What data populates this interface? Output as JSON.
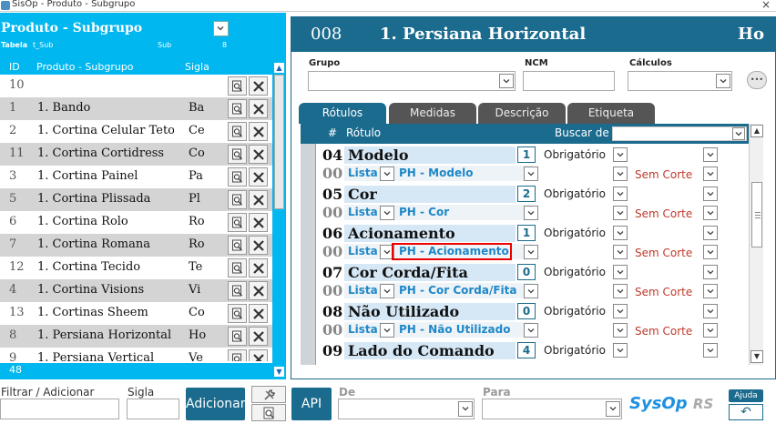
{
  "window": {
    "title": "SisOp - Produto - Subgrupo",
    "close_glyph": "×"
  },
  "left": {
    "header_title": "Produto - Subgrupo",
    "table_label": "Tabela",
    "table_value": "t_Sub",
    "sub_label": "Sub",
    "sub_value": "8",
    "columns": {
      "id": "ID",
      "name": "Produto - Subgrupo",
      "sigla": "Sigla"
    },
    "rows": [
      {
        "id": "10",
        "name": "",
        "sigla": ""
      },
      {
        "id": "1",
        "name": "1. Bando",
        "sigla": "Ba"
      },
      {
        "id": "2",
        "name": "1. Cortina Celular Teto",
        "sigla": "Ce"
      },
      {
        "id": "11",
        "name": "1. Cortina Cortidress",
        "sigla": "Co"
      },
      {
        "id": "3",
        "name": "1. Cortina Painel",
        "sigla": "Pa"
      },
      {
        "id": "5",
        "name": "1. Cortina Plissada",
        "sigla": "Pl"
      },
      {
        "id": "6",
        "name": "1. Cortina Rolo",
        "sigla": "Ro"
      },
      {
        "id": "7",
        "name": "1. Cortina Romana",
        "sigla": "Ro"
      },
      {
        "id": "12",
        "name": "1. Cortina Tecido",
        "sigla": "Te"
      },
      {
        "id": "4",
        "name": "1. Cortina Visions",
        "sigla": "Vi"
      },
      {
        "id": "13",
        "name": "1. Cortinas Sheem",
        "sigla": "Co"
      },
      {
        "id": "8",
        "name": "1. Persiana Horizontal",
        "sigla": "Ho"
      },
      {
        "id": "9",
        "name": "1. Persiana Vertical",
        "sigla": "Ve"
      }
    ],
    "footer_count": "48"
  },
  "right": {
    "code": "008",
    "title": "1. Persiana Horizontal",
    "sigla": "Ho",
    "fields": {
      "grupo": "Grupo",
      "ncm": "NCM",
      "calculos": "Cálculos"
    },
    "more_glyph": "•••",
    "tabs": [
      "Rótulos",
      "Medidas",
      "Descrição",
      "Etiqueta"
    ],
    "grid_header": {
      "hash": "#",
      "rotulo": "Rótulo",
      "buscar": "Buscar de"
    },
    "rows": [
      {
        "num": "04",
        "sub": "00",
        "name": "Modelo",
        "order": "1",
        "obrig": "Obrigatório",
        "tipo": "Lista",
        "value": "PH - Modelo",
        "corte": "Sem Corte"
      },
      {
        "num": "05",
        "sub": "00",
        "name": "Cor",
        "order": "2",
        "obrig": "Obrigatório",
        "tipo": "Lista",
        "value": "PH - Cor",
        "corte": "Sem Corte"
      },
      {
        "num": "06",
        "sub": "00",
        "name": "Acionamento",
        "order": "1",
        "obrig": "Obrigatório",
        "tipo": "Lista",
        "value": "PH - Acionamento",
        "corte": "Sem Corte"
      },
      {
        "num": "07",
        "sub": "00",
        "name": "Cor Corda/Fita",
        "order": "0",
        "obrig": "Obrigatório",
        "tipo": "Lista",
        "value": "PH - Cor Corda/Fita",
        "corte": "Sem Corte"
      },
      {
        "num": "08",
        "sub": "00",
        "name": "Não Utilizado",
        "order": "0",
        "obrig": "Obrigatório",
        "tipo": "Lista",
        "value": "PH - Não Utilizado",
        "corte": "Sem Corte"
      },
      {
        "num": "09",
        "sub": "",
        "name": "Lado do Comando",
        "order": "4",
        "obrig": "Obrigatório",
        "tipo": "",
        "value": "",
        "corte": ""
      }
    ]
  },
  "bottom": {
    "filtrar_label": "Filtrar / Adicionar",
    "sigla_label": "Sigla",
    "adicionar_label": "Adicionar",
    "api_label": "API",
    "de_label": "De",
    "para_label": "Para",
    "logo_main": "SysOp",
    "logo_rs": "RS",
    "help_label": "Ajuda",
    "undo_glyph": "↶"
  },
  "colors": {
    "accent": "#00b7ef",
    "header": "#1b6b8e",
    "value_text": "#1e88c8",
    "corte_text": "#c0392b",
    "highlight": "#ee0000"
  }
}
